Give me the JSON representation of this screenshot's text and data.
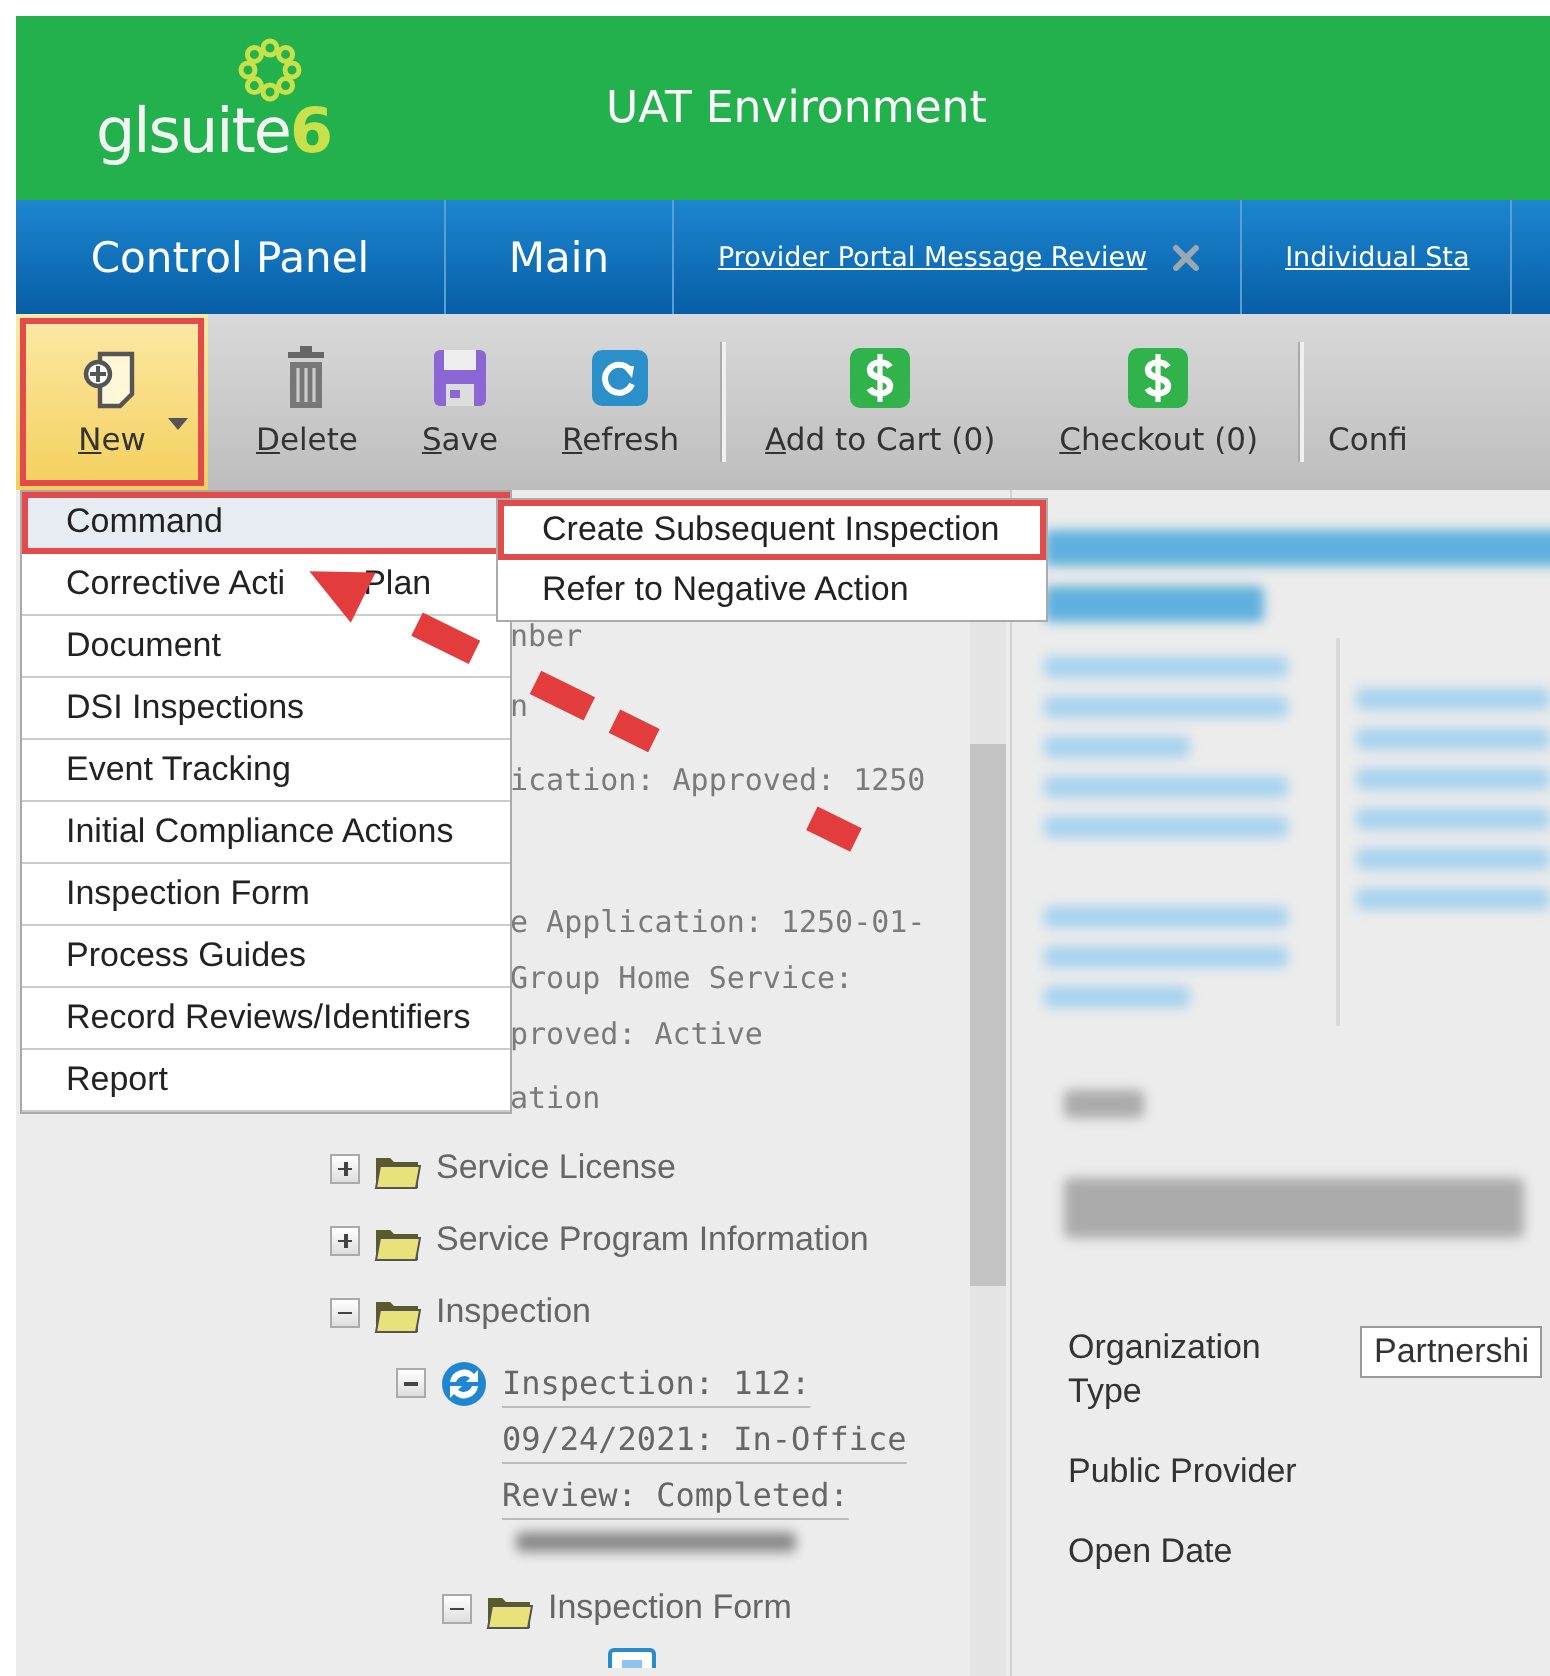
{
  "header": {
    "logo": {
      "name": "glsuite",
      "version": "6"
    },
    "environment": "UAT Environment"
  },
  "nav": [
    {
      "label": "Control Panel",
      "kind": "section"
    },
    {
      "label": "Main",
      "kind": "section"
    },
    {
      "label": "Provider Portal Message Review",
      "kind": "link",
      "closable": true
    },
    {
      "label": "Individual Sta",
      "kind": "link",
      "closable": false
    }
  ],
  "toolbar": [
    {
      "mnemonic": "N",
      "rest": "ew",
      "kind": "new",
      "dropdown": true,
      "active": true,
      "outlined": true
    },
    {
      "mnemonic": "D",
      "rest": "elete",
      "kind": "delete",
      "dropdown": false,
      "active": false,
      "outlined": false
    },
    {
      "mnemonic": "S",
      "rest": "ave",
      "kind": "save",
      "dropdown": false,
      "active": false,
      "outlined": false
    },
    {
      "mnemonic": "R",
      "rest": "efresh",
      "kind": "refresh",
      "dropdown": false,
      "active": false,
      "outlined": false
    },
    {
      "kind": "separator"
    },
    {
      "mnemonic": "A",
      "rest": "dd to Cart (0)",
      "kind": "money",
      "dropdown": false,
      "active": false,
      "outlined": false
    },
    {
      "mnemonic": "C",
      "rest": "heckout (0)",
      "kind": "money",
      "dropdown": false,
      "active": false,
      "outlined": false
    },
    {
      "kind": "separator"
    },
    {
      "rest": "Confi",
      "kind": "plain",
      "dropdown": false,
      "active": false,
      "outlined": false
    }
  ],
  "menu": [
    {
      "label_parts": [
        "Command"
      ],
      "selected": true,
      "outlined": true
    },
    {
      "label_parts": [
        "Corrective Acti",
        "Plan"
      ],
      "selected": false,
      "outlined": false
    },
    {
      "label_parts": [
        "Document"
      ],
      "selected": false,
      "outlined": false
    },
    {
      "label_parts": [
        "DSI Inspections"
      ],
      "selected": false,
      "outlined": false
    },
    {
      "label_parts": [
        "Event Tracking"
      ],
      "selected": false,
      "outlined": false
    },
    {
      "label_parts": [
        "Initial Compliance Actions"
      ],
      "selected": false,
      "outlined": false
    },
    {
      "label_parts": [
        "Inspection Form"
      ],
      "selected": false,
      "outlined": false
    },
    {
      "label_parts": [
        "Process Guides"
      ],
      "selected": false,
      "outlined": false
    },
    {
      "label_parts": [
        "Record Reviews/Identifiers"
      ],
      "selected": false,
      "outlined": false
    },
    {
      "label_parts": [
        "Report"
      ],
      "selected": false,
      "outlined": false
    }
  ],
  "submenu": [
    {
      "label_parts": [
        "Create Subsequent Inspection"
      ],
      "selected": false,
      "outlined": true
    },
    {
      "label_parts": [
        "Refer to Negative Action"
      ],
      "selected": false,
      "outlined": false
    }
  ],
  "annotation": {
    "arrow": true
  },
  "tree_fragments": [
    {
      "lines": [
        "nber"
      ]
    },
    {
      "lines": [
        "n"
      ]
    },
    {
      "lines": [
        "ication: Approved: 1250"
      ]
    },
    {
      "lines": [
        "e Application: 1250-01-",
        "Group Home Service:",
        "proved: Active"
      ]
    },
    {
      "lines": [
        "ation"
      ]
    }
  ],
  "tree": [
    {
      "label": "Service License",
      "kind": "folder",
      "expanded": false
    },
    {
      "label": "Service Program Information",
      "kind": "folder",
      "expanded": false
    },
    {
      "label": "Inspection",
      "kind": "folder",
      "expanded": true,
      "children": [
        {
          "label": "Inspection: 112: 09/24/2021: In-Office Review: Completed:",
          "kind": "record",
          "expanded": true,
          "children": [
            {
              "label": "Inspection Form",
              "kind": "folder",
              "expanded": true,
              "children": [
                {
                  "kind": "form"
                }
              ]
            }
          ]
        }
      ]
    }
  ],
  "details": {
    "fields": [
      {
        "label": "Organization Type",
        "value": "Partnershi",
        "kind": "input"
      },
      {
        "label": "Public Provider",
        "kind": "text"
      },
      {
        "label": "Open Date",
        "kind": "text"
      }
    ]
  }
}
